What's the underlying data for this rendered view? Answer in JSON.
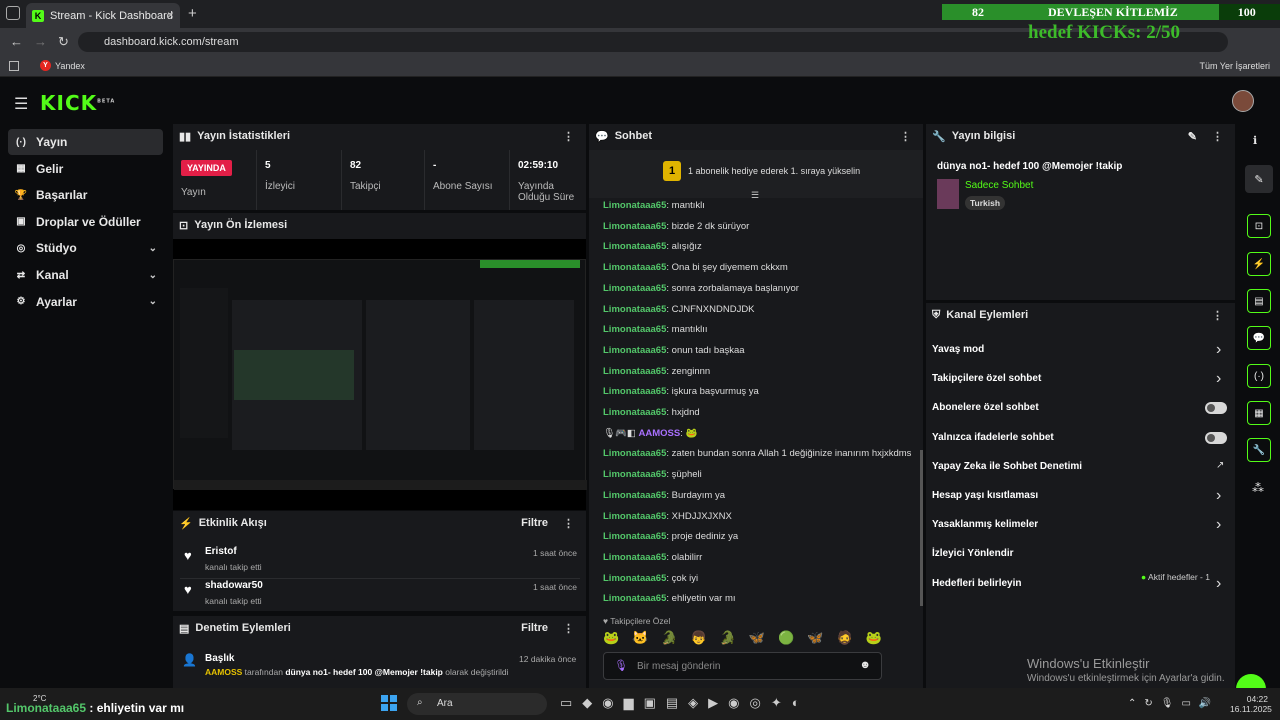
{
  "browser": {
    "tab_title": "Stream - Kick Dashboard",
    "url": "dashboard.kick.com/stream",
    "bookmark": "Yandex",
    "bookmark_y": "Y",
    "all_bookmarks": "Tüm Yer İşaretleri",
    "new_tab": "+",
    "close_tab": "×",
    "back": "←",
    "forward": "→",
    "reload": "↻"
  },
  "overlay": {
    "current": "82",
    "title": "DEVLEŞEN KİTLEMİZ",
    "target": "100",
    "goal_text": "hedef KICKs: 2/50",
    "progress": 0.82
  },
  "brand": {
    "logo": "KICK",
    "beta": "BETA"
  },
  "sidebar": [
    {
      "label": "Yayın",
      "icon": "(·)",
      "chev": ""
    },
    {
      "label": "Gelir",
      "icon": "▦",
      "chev": ""
    },
    {
      "label": "Başarılar",
      "icon": "🏆",
      "chev": ""
    },
    {
      "label": "Droplar ve Ödüller",
      "icon": "▣",
      "chev": ""
    },
    {
      "label": "Stüdyo",
      "icon": "◎",
      "chev": "⌄"
    },
    {
      "label": "Kanal",
      "icon": "⇄",
      "chev": "⌄"
    },
    {
      "label": "Ayarlar",
      "icon": "⚙",
      "chev": "⌄"
    }
  ],
  "stats": {
    "header": "Yayın İstatistikleri",
    "badge": "YAYINDA",
    "badge_label": "Yayın",
    "cells": [
      {
        "value": "5",
        "label": "İzleyici"
      },
      {
        "value": "82",
        "label": "Takipçi"
      },
      {
        "value": "-",
        "label": "Abone Sayısı"
      },
      {
        "value": "02:59:10",
        "label": "Yayında Olduğu Süre"
      }
    ]
  },
  "preview": {
    "header": "Yayın Ön İzlemesi"
  },
  "activity": {
    "header": "Etkinlik Akışı",
    "filter": "Filtre",
    "items": [
      {
        "name": "Eristof",
        "sub": "kanalı takip etti",
        "time": "1 saat önce"
      },
      {
        "name": "shadowar50",
        "sub": "kanalı takip etti",
        "time": "1 saat önce"
      }
    ]
  },
  "moderation": {
    "header": "Denetim Eylemleri",
    "filter": "Filtre",
    "title": "Başlık",
    "time": "12 dakika önce",
    "actor": "AAMOSS",
    "mid": " tarafından ",
    "bold": "dünya no1- hedef 100 @Memojer !takip",
    "end": " olarak değiştirildi"
  },
  "chat": {
    "header": "Sohbet",
    "pinned": "1 abonelik hediye ederek 1. sıraya yükselin",
    "pinned_num": "1",
    "lines": [
      {
        "user": "Limonataaa65",
        "text": "mantıklı"
      },
      {
        "user": "Limonataaa65",
        "text": "bizde 2 dk sürüyor"
      },
      {
        "user": "Limonataaa65",
        "text": "alışığız"
      },
      {
        "user": "Limonataaa65",
        "text": "Ona bi şey diyemem ckkxm"
      },
      {
        "user": "Limonataaa65",
        "text": "sonra zorbalamaya başlanıyor"
      },
      {
        "user": "Limonataaa65",
        "text": "CJNFNXNDNDJDK"
      },
      {
        "user": "Limonataaa65",
        "text": "mantıklıı"
      },
      {
        "user": "Limonataaa65",
        "text": "onun tadı başkaa"
      },
      {
        "user": "Limonataaa65",
        "text": "zenginnn"
      },
      {
        "user": "Limonataaa65",
        "text": "işkura başvurmuş ya"
      },
      {
        "user": "Limonataaa65",
        "text": "hxjdnd"
      },
      {
        "user": "AAMOSS",
        "text": "🐸"
      },
      {
        "user": "Limonataaa65",
        "text": "zaten bundan sonra Allah 1 değiğinize inanırım hxjxkdms"
      },
      {
        "user": "Limonataaa65",
        "text": "şüpheli"
      },
      {
        "user": "Limonataaa65",
        "text": "Burdayım ya"
      },
      {
        "user": "Limonataaa65",
        "text": "XHDJJXJXNX"
      },
      {
        "user": "Limonataaa65",
        "text": "proje dediniz ya"
      },
      {
        "user": "Limonataaa65",
        "text": "olabilirr"
      },
      {
        "user": "Limonataaa65",
        "text": "çok iyi"
      },
      {
        "user": "Limonataaa65",
        "text": "ehliyetin var mı"
      }
    ],
    "followers_only": "Takipçilere Özel",
    "placeholder": "Bir mesaj gönderin"
  },
  "info": {
    "header": "Yayın bilgisi",
    "title": "dünya no1- hedef 100 @Memojer !takip",
    "category": "Sadece Sohbet",
    "tag": "Turkish"
  },
  "actions": {
    "header": "Kanal Eylemleri",
    "items": [
      {
        "label": "Yavaş mod",
        "ctrl": "arrow"
      },
      {
        "label": "Takipçilere özel sohbet",
        "ctrl": "arrow"
      },
      {
        "label": "Abonelere özel sohbet",
        "ctrl": "toggle"
      },
      {
        "label": "Yalnızca ifadelerle sohbet",
        "ctrl": "toggle"
      },
      {
        "label": "Yapay Zeka ile Sohbet Denetimi",
        "ctrl": "ext"
      },
      {
        "label": "Hesap yaşı kısıtlaması",
        "ctrl": "arrow"
      },
      {
        "label": "Yasaklanmış kelimeler",
        "ctrl": "arrow"
      },
      {
        "label": "İzleyici Yönlendir",
        "ctrl": "none"
      },
      {
        "label": "Hedefleri belirleyin",
        "ctrl": "arrow"
      }
    ],
    "active_goals": "Aktif hedefler - 1"
  },
  "windows": {
    "activate_title": "Windows'u Etkinleştir",
    "activate_sub": "Windows'u etkinleştirmek için Ayarlar'a gidin.",
    "search": "Ara",
    "temp": "2°C",
    "time": "04:22",
    "date": "16.11.2025"
  },
  "bottom_overlay": {
    "user": "Limonataaa65",
    "text": " : ehliyetin var mı"
  }
}
